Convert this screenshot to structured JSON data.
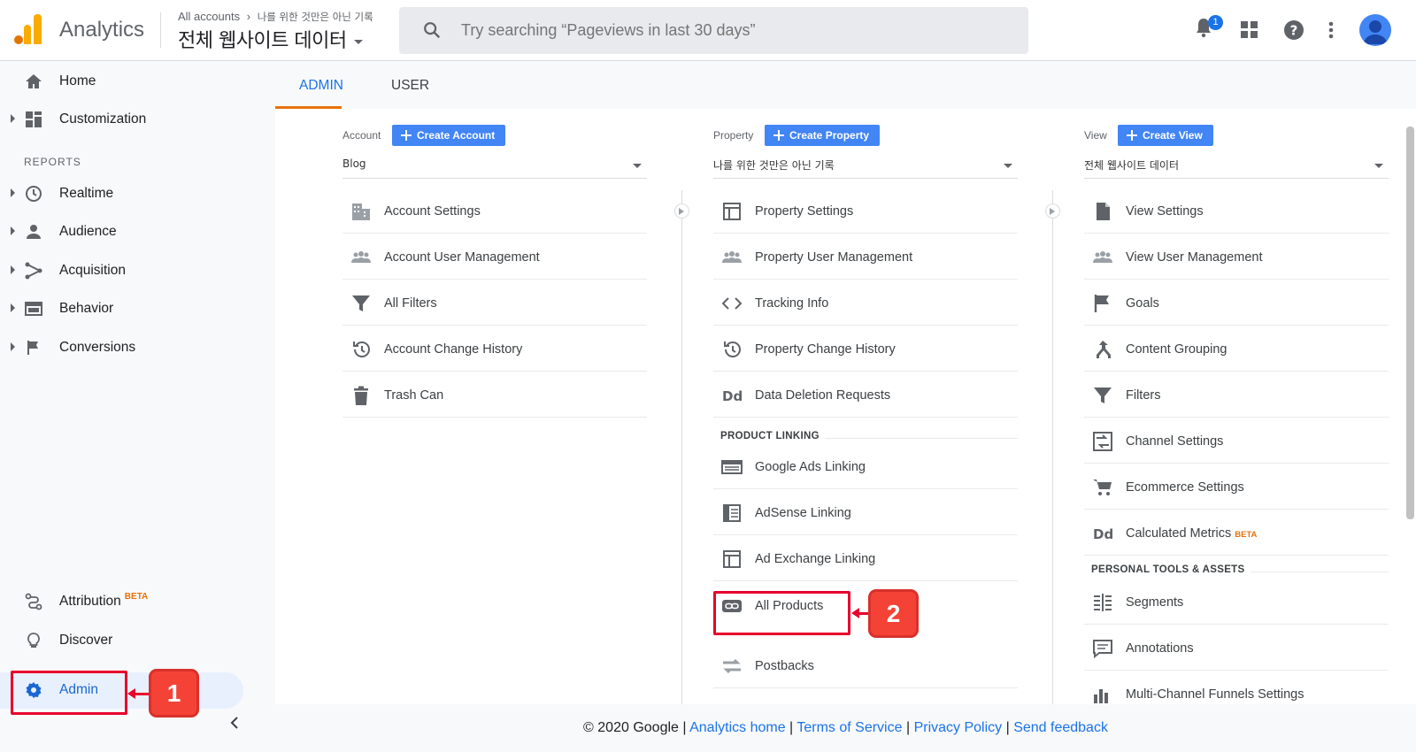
{
  "header": {
    "app_name": "Analytics",
    "breadcrumb": [
      "All accounts",
      "나를 위한 것만은 아닌 기록"
    ],
    "property_title": "전체 웹사이트 데이터",
    "search_placeholder": "Try searching “Pageviews in last 30 days”",
    "notification_count": "1"
  },
  "sidebar": {
    "items": [
      {
        "label": "Home",
        "icon": "home-icon"
      },
      {
        "label": "Customization",
        "icon": "dashboard-icon"
      }
    ],
    "reports_heading": "REPORTS",
    "report_items": [
      {
        "label": "Realtime",
        "icon": "clock-icon"
      },
      {
        "label": "Audience",
        "icon": "person-icon"
      },
      {
        "label": "Acquisition",
        "icon": "acquisition-icon"
      },
      {
        "label": "Behavior",
        "icon": "behavior-icon"
      },
      {
        "label": "Conversions",
        "icon": "flag-icon"
      }
    ],
    "bottom_items": [
      {
        "label": "Attribution",
        "badge": "BETA",
        "icon": "attribution-icon"
      },
      {
        "label": "Discover",
        "icon": "lightbulb-icon"
      },
      {
        "label": "Admin",
        "icon": "gear-icon",
        "selected": true
      }
    ]
  },
  "tabs": [
    {
      "label": "ADMIN",
      "active": true
    },
    {
      "label": "USER",
      "active": false
    }
  ],
  "account_column": {
    "label": "Account",
    "create_button": "Create Account",
    "selected": "Blog",
    "items": [
      {
        "label": "Account Settings",
        "icon": "building-icon"
      },
      {
        "label": "Account User Management",
        "icon": "people-icon"
      },
      {
        "label": "All Filters",
        "icon": "filter-icon"
      },
      {
        "label": "Account Change History",
        "icon": "history-icon"
      },
      {
        "label": "Trash Can",
        "icon": "trash-icon"
      }
    ]
  },
  "property_column": {
    "label": "Property",
    "create_button": "Create Property",
    "selected": "나를 위한 것만은 아닌 기록",
    "items": [
      {
        "label": "Property Settings",
        "icon": "window-icon"
      },
      {
        "label": "Property User Management",
        "icon": "people-icon"
      },
      {
        "label": "Tracking Info",
        "icon": "code-icon"
      },
      {
        "label": "Property Change History",
        "icon": "history-icon"
      },
      {
        "label": "Data Deletion Requests",
        "icon": "dd-icon"
      }
    ],
    "linking_heading": "PRODUCT LINKING",
    "linking_items": [
      {
        "label": "Google Ads Linking",
        "icon": "ads-icon"
      },
      {
        "label": "AdSense Linking",
        "icon": "adsense-icon"
      },
      {
        "label": "Ad Exchange Linking",
        "icon": "window-icon"
      },
      {
        "label": "All Products",
        "icon": "link-icon"
      },
      {
        "label": "Postbacks",
        "icon": "postbacks-icon"
      }
    ]
  },
  "view_column": {
    "label": "View",
    "create_button": "Create View",
    "selected": "전체 웹사이트 데이터",
    "items": [
      {
        "label": "View Settings",
        "icon": "document-icon"
      },
      {
        "label": "View User Management",
        "icon": "people-icon"
      },
      {
        "label": "Goals",
        "icon": "flag-icon"
      },
      {
        "label": "Content Grouping",
        "icon": "grouping-icon"
      },
      {
        "label": "Filters",
        "icon": "filter-icon"
      },
      {
        "label": "Channel Settings",
        "icon": "channel-icon"
      },
      {
        "label": "Ecommerce Settings",
        "icon": "cart-icon"
      },
      {
        "label": "Calculated Metrics",
        "badge": "BETA",
        "icon": "dd-icon"
      }
    ],
    "personal_heading": "PERSONAL TOOLS & ASSETS",
    "personal_items": [
      {
        "label": "Segments",
        "icon": "segments-icon"
      },
      {
        "label": "Annotations",
        "icon": "annotation-icon"
      },
      {
        "label": "Multi-Channel Funnels Settings",
        "icon": "funnels-icon"
      }
    ]
  },
  "footer": {
    "copyright": "© 2020 Google",
    "sep": "|",
    "links": [
      "Analytics home",
      "Terms of Service",
      "Privacy Policy",
      "Send feedback"
    ]
  },
  "callouts": [
    "1",
    "2"
  ],
  "colors": {
    "accent": "#1a73e8",
    "button": "#4285f4",
    "tab_underline": "#e8710a",
    "highlight": "#e8002d",
    "callout": "#f44336"
  }
}
